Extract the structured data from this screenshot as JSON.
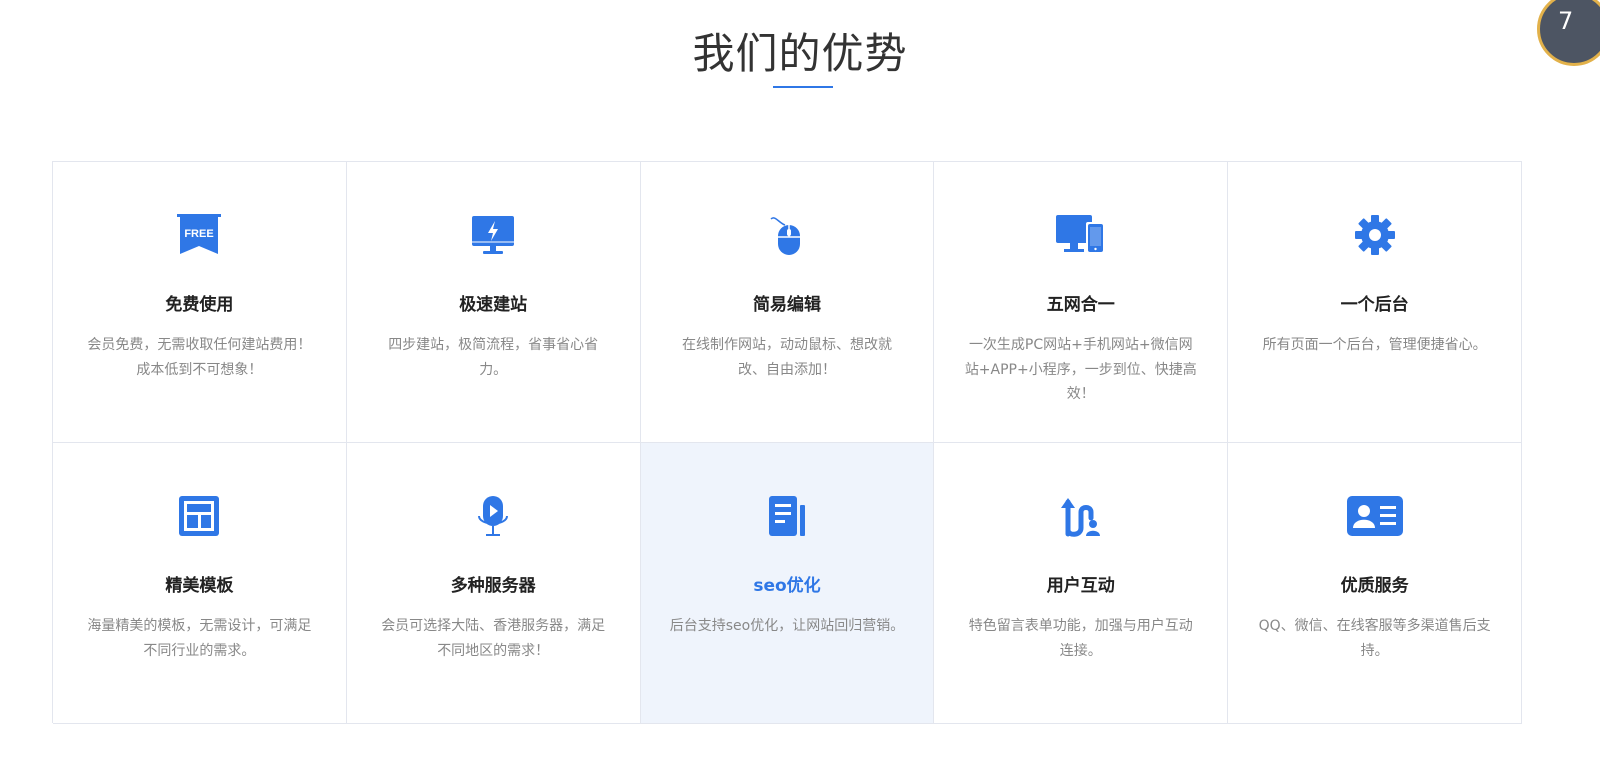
{
  "section": {
    "title": "我们的优势"
  },
  "badge_text": "7",
  "accent_color": "#2f77e6",
  "features": [
    {
      "icon": "free-ribbon-icon",
      "title": "免费使用",
      "desc": "会员免费，无需收取任何建站费用！成本低到不可想象！"
    },
    {
      "icon": "monitor-lightning-icon",
      "title": "极速建站",
      "desc": "四步建站，极简流程，省事省心省力。"
    },
    {
      "icon": "mouse-icon",
      "title": "简易编辑",
      "desc": "在线制作网站，动动鼠标、想改就改、自由添加！"
    },
    {
      "icon": "desktop-mobile-icon",
      "title": "五网合一",
      "desc": "一次生成PC网站+手机网站+微信网站+APP+小程序，一步到位、快捷高效！"
    },
    {
      "icon": "gear-icon",
      "title": "一个后台",
      "desc": "所有页面一个后台，管理便捷省心。"
    },
    {
      "icon": "template-layout-icon",
      "title": "精美模板",
      "desc": "海量精美的模板，无需设计，可满足不同行业的需求。"
    },
    {
      "icon": "microphone-play-icon",
      "title": "多种服务器",
      "desc": "会员可选择大陆、香港服务器，满足不同地区的需求！"
    },
    {
      "icon": "document-icon",
      "title": "seo优化",
      "desc": "后台支持seo优化，让网站回归营销。"
    },
    {
      "icon": "user-interaction-icon",
      "title": "用户互动",
      "desc": "特色留言表单功能，加强与用户互动连接。"
    },
    {
      "icon": "id-card-icon",
      "title": "优质服务",
      "desc": "QQ、微信、在线客服等多渠道售后支持。"
    }
  ]
}
